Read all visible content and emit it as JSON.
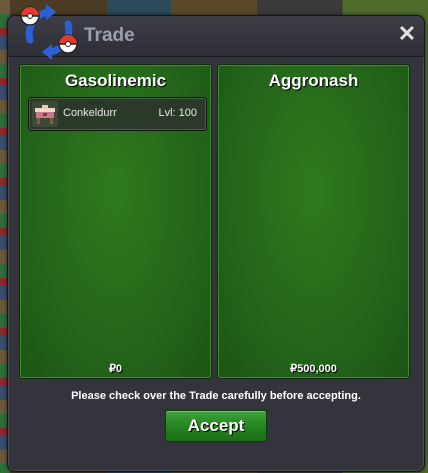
{
  "window": {
    "title": "Trade",
    "close_symbol": "✕"
  },
  "left_panel": {
    "player_name": "Gasolinemic",
    "money": "₽0",
    "items": [
      {
        "icon": "pokemon-sprite-icon",
        "name": "Conkeldurr",
        "level": "Lvl: 100"
      }
    ]
  },
  "right_panel": {
    "player_name": "Aggronash",
    "money": "₽500,000",
    "items": []
  },
  "footer": {
    "notice": "Please check over the Trade carefully before accepting.",
    "accept_label": "Accept"
  },
  "colors": {
    "panel_green": "#23651a",
    "accept_green": "#24831f",
    "window_bg": "#34343c",
    "title_text": "#9aa0ac"
  }
}
